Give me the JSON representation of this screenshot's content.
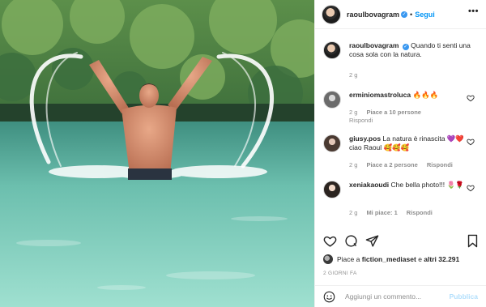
{
  "post": {
    "username": "raoulbovagram",
    "follow_label": "Segui",
    "separator": "•",
    "more_icon": "•••"
  },
  "caption": {
    "username": "raoulbovagram",
    "text": "Quando ti senti una cosa sola con la natura.",
    "time": "2 g"
  },
  "comments": [
    {
      "username": "erminiomastroluca",
      "text": "🔥🔥🔥",
      "time": "2 g",
      "likes": "Piace a 10 persone",
      "reply": "Rispondi"
    },
    {
      "username": "giusy.pos",
      "text": "La natura è rinascita 💜❤️ ciao Raoul 🥰🥰🥰",
      "time": "2 g",
      "likes": "Piace a 2 persone",
      "reply": "Rispondi"
    },
    {
      "username": "xeniakaoudi",
      "text": "Che bella photo!!! 🌷🌹",
      "time": "2 g",
      "likes": "Mi piace: 1",
      "reply": "Rispondi"
    }
  ],
  "likes": {
    "prefix": "Piace a",
    "user": "fiction_mediaset",
    "middle": "e",
    "count": "altri 32.291"
  },
  "timestamp": "2 GIORNI FA",
  "add_comment": {
    "placeholder": "Aggiungi un commento...",
    "publish_label": "Pubblica"
  },
  "colors": {
    "accent": "#0095f6",
    "verified": "#3897f0",
    "water": "#5fb3a0",
    "foliage": "#2f6b3a"
  }
}
